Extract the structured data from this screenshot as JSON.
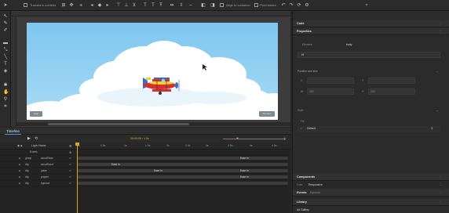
{
  "toolbar": {
    "transform_controls_label": "Transform controls",
    "align_label": "Align to container",
    "pixel_label": "Pixel based"
  },
  "stage": {
    "left_button": "Help",
    "right_button": "Preview"
  },
  "timeline": {
    "tab": "Timeline",
    "current_time": "00:00:00 / 1.5s",
    "header_label": "Layer Name",
    "ticks": [
      "0s",
      "0.5s",
      "1s",
      "1.5s",
      "2s",
      "2.5s",
      "3s",
      "3.5s",
      "4s",
      "4.5s"
    ],
    "subheader": "Events",
    "rows": [
      {
        "layer": "group",
        "name": "cloudShow",
        "key_label": "Ease In",
        "key_col": "right"
      },
      {
        "layer": "clip",
        "name": "cloudScout",
        "key_label": "Ease In",
        "key_col": "left"
      },
      {
        "layer": "clip",
        "name": "plane",
        "key_label": "Ease In",
        "key_col": "mid"
      },
      {
        "layer": "clip",
        "name": "propell",
        "key_label": "Ease In",
        "key_col": "right"
      },
      {
        "layer": "clip",
        "name": "bgcloud",
        "key_label": "",
        "key_col": ""
      }
    ]
  },
  "right_panel": {
    "code_header": "Code",
    "properties_header": "Properties",
    "element_label": "Element",
    "element_value": "body",
    "id_value": "bf",
    "position_header": "Position and size",
    "x_label": "X",
    "y_label": "Y",
    "w_label": "W",
    "w_value": "400",
    "h_label": "H",
    "h_value": "200",
    "style_label": "Style",
    "fill_label": "Fill",
    "fill_value": "Default",
    "components_header": "Components",
    "components_tab_active": "Responsive",
    "components_tab_other": "Core",
    "events_header": "Events",
    "events_tab": "Dynamic",
    "library_header": "Library",
    "library_sub": "Ad Gallery"
  },
  "colors": {
    "accent": "#4b8fe0",
    "playhead": "#e4a11b",
    "sky_top": "#7ec6ef",
    "plane_red": "#d62f2f",
    "plane_yellow": "#f2d02d",
    "plane_blue": "#2f6fd1"
  }
}
